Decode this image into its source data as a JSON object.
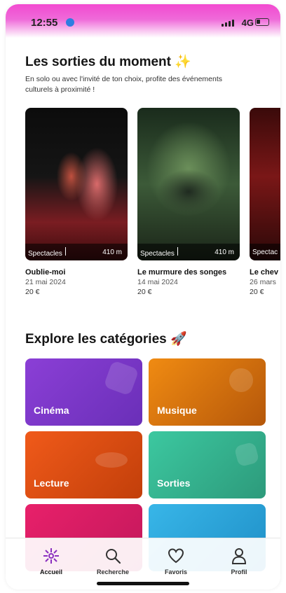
{
  "status_bar": {
    "time": "12:55",
    "network": "4G"
  },
  "header": {
    "title": "Les sorties du moment ✨",
    "subtitle": "En solo ou avec l'invité de ton choix, profite des événements culturels à proximité !"
  },
  "events": [
    {
      "category": "Spectacles",
      "distance": "410 m",
      "title": "Oublie-moi",
      "date": "21 mai 2024",
      "price": "20 €"
    },
    {
      "category": "Spectacles",
      "distance": "410 m",
      "title": "Le murmure des songes",
      "date": "14 mai 2024",
      "price": "20 €"
    },
    {
      "category": "Spectac",
      "distance": "",
      "title": "Le chev",
      "date": "26 mars",
      "price": "20 €"
    }
  ],
  "categories_section": {
    "title": "Explore les catégories 🚀",
    "tiles": [
      {
        "label": "Cinéma",
        "color": "#7a35c8"
      },
      {
        "label": "Musique",
        "color": "#d9730f"
      },
      {
        "label": "Lecture",
        "color": "#e0500f"
      },
      {
        "label": "Sorties",
        "color": "#35b58f"
      },
      {
        "label": "",
        "color": "#e0206a"
      },
      {
        "label": "",
        "color": "#2fa6dc"
      }
    ]
  },
  "tabbar": {
    "items": [
      {
        "label": "Accueil",
        "icon": "home-flower-icon",
        "active": true
      },
      {
        "label": "Recherche",
        "icon": "search-icon",
        "active": false
      },
      {
        "label": "Favoris",
        "icon": "heart-icon",
        "active": false
      },
      {
        "label": "Profil",
        "icon": "user-icon",
        "active": false
      }
    ]
  }
}
